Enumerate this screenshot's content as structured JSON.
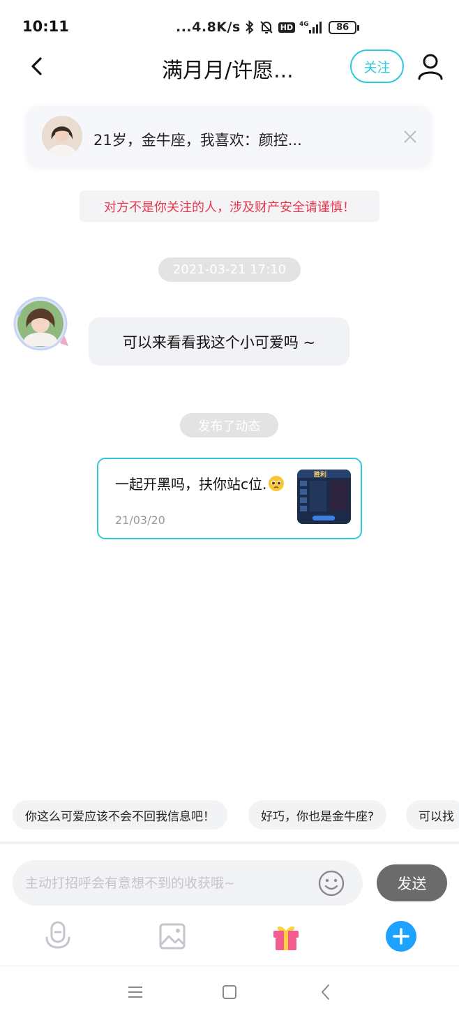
{
  "status_bar": {
    "time": "10:11",
    "speed": "...4.8K/s",
    "hd": "HD",
    "network": "4G",
    "battery": "86"
  },
  "header": {
    "title": "满月月/许愿...",
    "follow_label": "关注",
    "accent_color": "#2ec9dc"
  },
  "profile_card": {
    "text": "21岁，金牛座，我喜欢：颜控..."
  },
  "warning": {
    "text": "对方不是你关注的人，涉及财产安全请谨慎！",
    "color": "#e6394f"
  },
  "chat": {
    "timestamp": "2021-03-21 17:10",
    "message": "可以来看看我这个小可爱吗 ~",
    "posted_label": "发布了动态",
    "post": {
      "text": "一起开黑吗，扶你站c位.",
      "date": "21/03/20",
      "thumb_label": "胜利"
    }
  },
  "quick_replies": [
    "你这么可爱应该不会不回我信息吧！",
    "好巧，你也是金牛座?",
    "可以找"
  ],
  "input": {
    "placeholder": "主动打招呼会有意想不到的收获哦~",
    "send_label": "发送"
  },
  "toolbar": {
    "icons": [
      "microphone-icon",
      "image-icon",
      "gift-icon",
      "plus-icon"
    ]
  }
}
